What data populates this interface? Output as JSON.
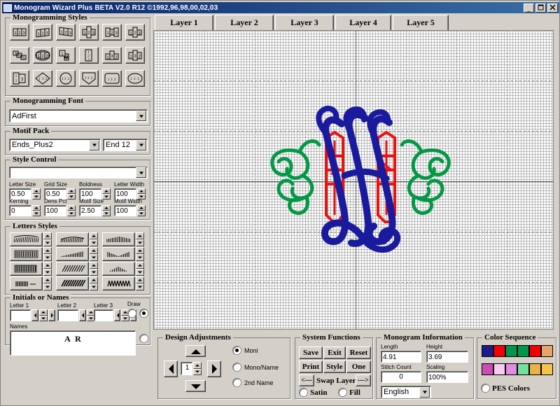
{
  "window": {
    "title": "Monogram Wizard Plus BETA V2.0 R12 ©1992,96,98,00,02,03",
    "minimize": "_",
    "maximize": "□",
    "close": "✕"
  },
  "tabs": [
    {
      "label": "Layer 1"
    },
    {
      "label": "Layer 2"
    },
    {
      "label": "Layer 3"
    },
    {
      "label": "Layer 4"
    },
    {
      "label": "Layer 5"
    }
  ],
  "monogramming_styles": {
    "title": "Monogramming Styles",
    "count": 18
  },
  "monogramming_font": {
    "title": "Monogramming Font",
    "value": "AdFirst"
  },
  "motif_pack": {
    "title": "Motif Pack",
    "pack": "Ends_Plus2",
    "end": "End  12"
  },
  "style_control": {
    "title": "Style Control",
    "value": "",
    "fields": [
      {
        "label": "Letter Size",
        "value": "0.50"
      },
      {
        "label": "Grid Size",
        "value": "0.50"
      },
      {
        "label": "Boldness",
        "value": "100"
      },
      {
        "label": "Letter Width",
        "value": "100"
      },
      {
        "label": "Kerning",
        "value": "0"
      },
      {
        "label": "Dens Pct",
        "value": "100"
      },
      {
        "label": "Motif Size",
        "value": "2.50"
      },
      {
        "label": "Motif Width",
        "value": "100"
      }
    ]
  },
  "letters_styles": {
    "title": "Letters Styles",
    "count": 12
  },
  "initials_or_names": {
    "title": "Initials or Names",
    "letter1_label": "Letter 1",
    "letter2_label": "Letter 2",
    "letter3_label": "Letter 3",
    "letter1_value": "",
    "letter2_value": "",
    "letter3_value": "",
    "draw_label": "Draw",
    "names_label": "Names",
    "names_value": "A R"
  },
  "design_adjustments": {
    "title": "Design Adjustments",
    "counter": "1",
    "options": [
      {
        "label": "Moni",
        "selected": true
      },
      {
        "label": "Mono/Name",
        "selected": false
      },
      {
        "label": "2nd Name",
        "selected": false
      }
    ]
  },
  "system_functions": {
    "title": "System Functions",
    "buttons": [
      {
        "label": "Save"
      },
      {
        "label": "Exit"
      },
      {
        "label": "Reset"
      },
      {
        "label": "Print"
      },
      {
        "label": "Style"
      },
      {
        "label": "One"
      }
    ],
    "swap_layer_label": "Swap Layer",
    "swap_prev": "<—",
    "swap_next": "—>",
    "satin_label": "Satin",
    "fill_label": "Fill"
  },
  "monogram_information": {
    "title": "Monogram Information",
    "length_label": "Length",
    "length_value": "4.91",
    "height_label": "Height",
    "height_value": "3.69",
    "stitch_count_label": "Stitch Count",
    "stitch_count_value": "0",
    "scaling_label": "Scaling",
    "scaling_value": "100%",
    "language": "English"
  },
  "color_sequence": {
    "title": "Color Sequence",
    "row1": [
      "#201a8c",
      "#f40000",
      "#00954a",
      "#00954a",
      "#f40000",
      "#e8a368"
    ],
    "row2": [
      "#cc4cb4",
      "#f6ccf0",
      "#e08ce0",
      "#74e0a0",
      "#e8b441",
      "#f4c44a"
    ],
    "pes_label": "PES Colors"
  },
  "design": {
    "letter_color": "#1a1a9e",
    "motif_color": "#ee1111",
    "flourish_color": "#009944"
  }
}
